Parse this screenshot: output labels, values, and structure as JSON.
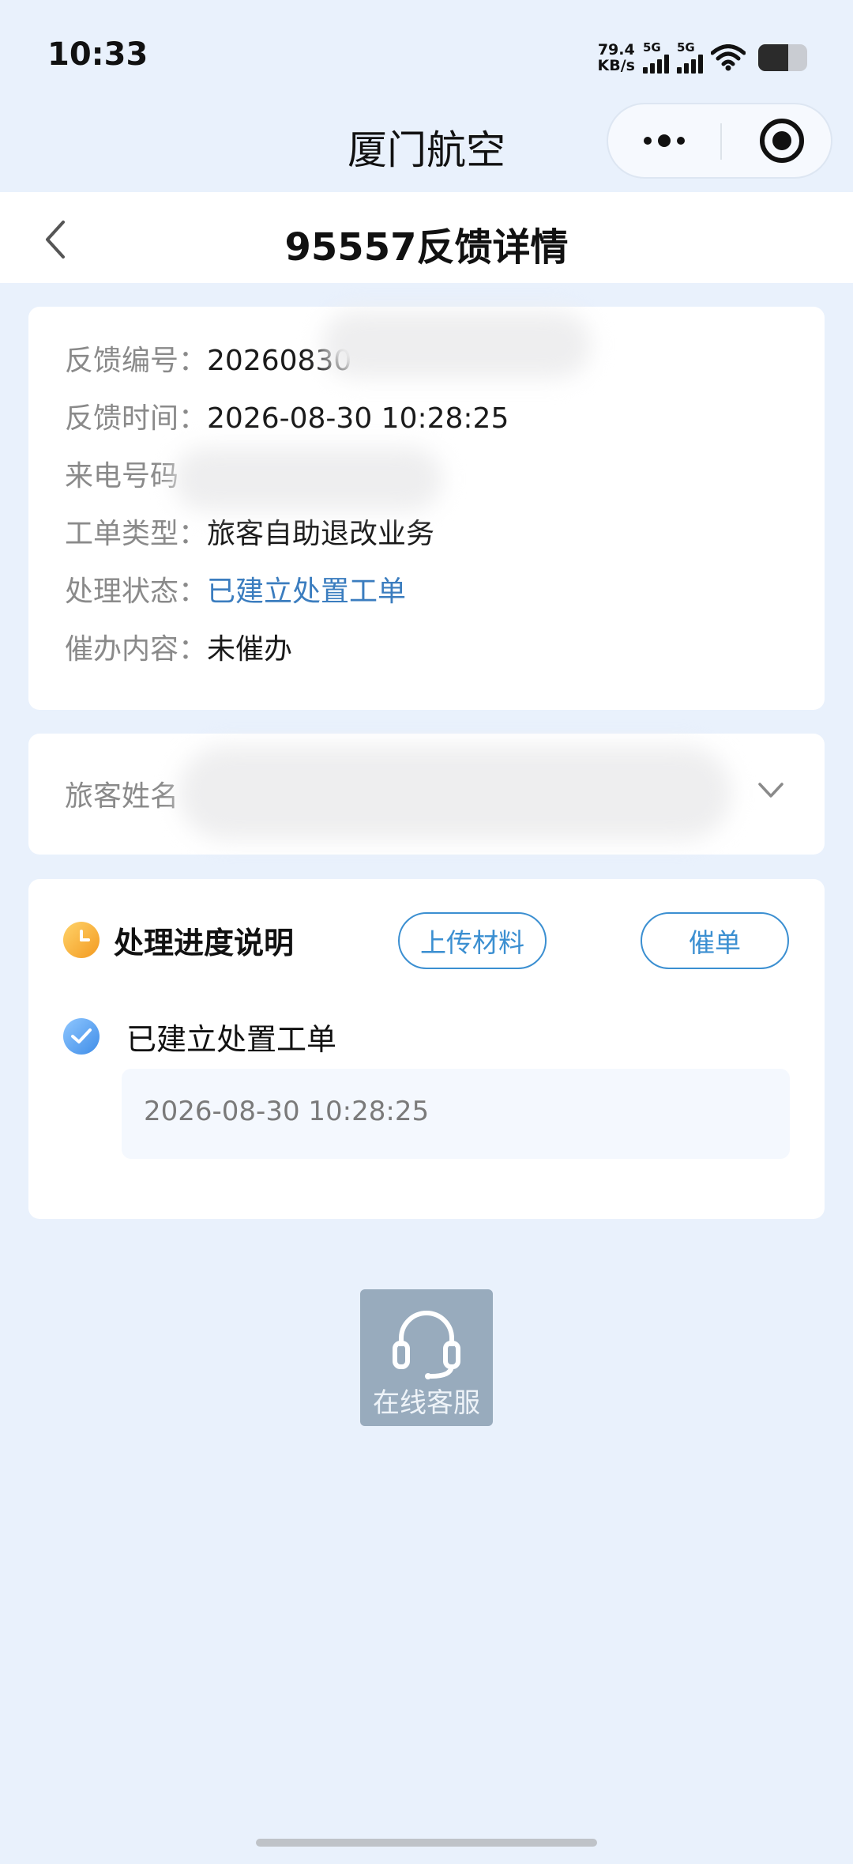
{
  "status_bar": {
    "time": "10:33",
    "net_speed_value": "79.4",
    "net_speed_unit": "KB/s",
    "sim1_label": "5G",
    "sim2_label": "5G",
    "battery_level": 0.62
  },
  "mini_program": {
    "title": "厦门航空"
  },
  "header": {
    "title": "95557反馈详情"
  },
  "info": {
    "feedback_no_label": "反馈编号：",
    "feedback_no_value": "20260830",
    "feedback_time_label": "反馈时间：",
    "feedback_time_value": "2026-08-30 10:28:25",
    "caller_label": "来电号码",
    "ticket_type_label": "工单类型：",
    "ticket_type_value": "旅客自助退改业务",
    "status_label": "处理状态：",
    "status_value": "已建立处置工单",
    "urge_content_label": "催办内容：",
    "urge_content_value": "未催办"
  },
  "passenger": {
    "label": "旅客姓名"
  },
  "progress": {
    "title": "处理进度说明",
    "upload_button": "上传材料",
    "urge_button": "催单",
    "step_title": "已建立处置工单",
    "step_time": "2026-08-30 10:28:25"
  },
  "floating": {
    "service_label": "在线客服"
  },
  "colors": {
    "accent_blue": "#3b8fd1",
    "status_blue": "#3b7dbf",
    "background": "#e9f1fc",
    "service_bg": "#98abbd"
  }
}
